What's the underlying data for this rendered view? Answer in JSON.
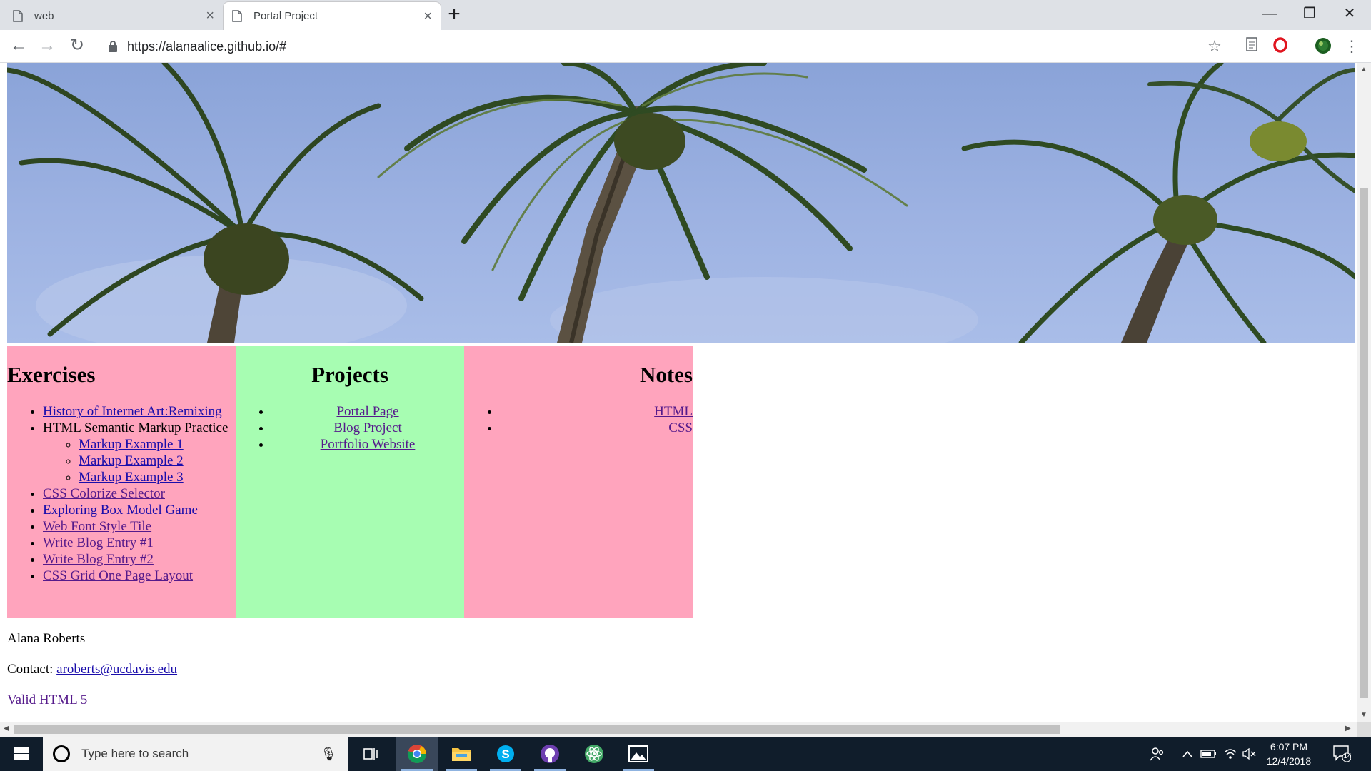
{
  "browser": {
    "tabs": [
      {
        "title": "web",
        "close": "×"
      },
      {
        "title": "Portal Project",
        "close": "×"
      }
    ],
    "new_tab": "+",
    "window_controls": {
      "minimize": "—",
      "maximize": "❐",
      "close": "✕"
    },
    "nav": {
      "back": "←",
      "forward": "→",
      "reload": "↻"
    },
    "url": "https://alanaalice.github.io/#",
    "toolbar_icons": [
      "star-icon",
      "reader-icon",
      "opera-icon",
      "profile-icon",
      "menu-icon"
    ]
  },
  "page": {
    "columns": [
      {
        "heading": "Exercises",
        "items": [
          {
            "label": "History of Internet Art:Remixing",
            "link": true
          },
          {
            "label": "HTML Semantic Markup Practice",
            "link": false,
            "children": [
              "Markup Example 1",
              "Markup Example 2",
              "Markup Example 3"
            ]
          },
          {
            "label": "CSS Colorize Selector",
            "link": true
          },
          {
            "label": "Exploring Box Model Game",
            "link": true
          },
          {
            "label": "Web Font Style Tile",
            "link": true
          },
          {
            "label": "Write Blog Entry #1",
            "link": true
          },
          {
            "label": "Write Blog Entry #2",
            "link": true
          },
          {
            "label": "CSS Grid One Page Layout",
            "link": true
          }
        ]
      },
      {
        "heading": "Projects",
        "items": [
          {
            "label": "Portal Page",
            "link": true
          },
          {
            "label": "Blog Project",
            "link": true
          },
          {
            "label": "Portfolio Website",
            "link": true
          }
        ]
      },
      {
        "heading": "Notes",
        "items": [
          {
            "label": "HTML",
            "link": true
          },
          {
            "label": "CSS",
            "link": true
          }
        ]
      }
    ],
    "footer": {
      "name": "Alana Roberts",
      "contact_label": "Contact:",
      "email": "aroberts@ucdavis.edu",
      "valid": "Valid HTML 5"
    },
    "colors": {
      "pink": "#ffa4bd",
      "green": "#a7fdb2",
      "link": "#1a0dab",
      "visited": "#551a8b"
    }
  },
  "taskbar": {
    "search_placeholder": "Type here to search",
    "apps": [
      "task-view-icon",
      "chrome-icon",
      "file-explorer-icon",
      "skype-icon",
      "github-icon",
      "atom-icon",
      "photos-icon"
    ],
    "clock": {
      "time": "6:07 PM",
      "date": "12/4/2018"
    },
    "notifications": "14"
  }
}
